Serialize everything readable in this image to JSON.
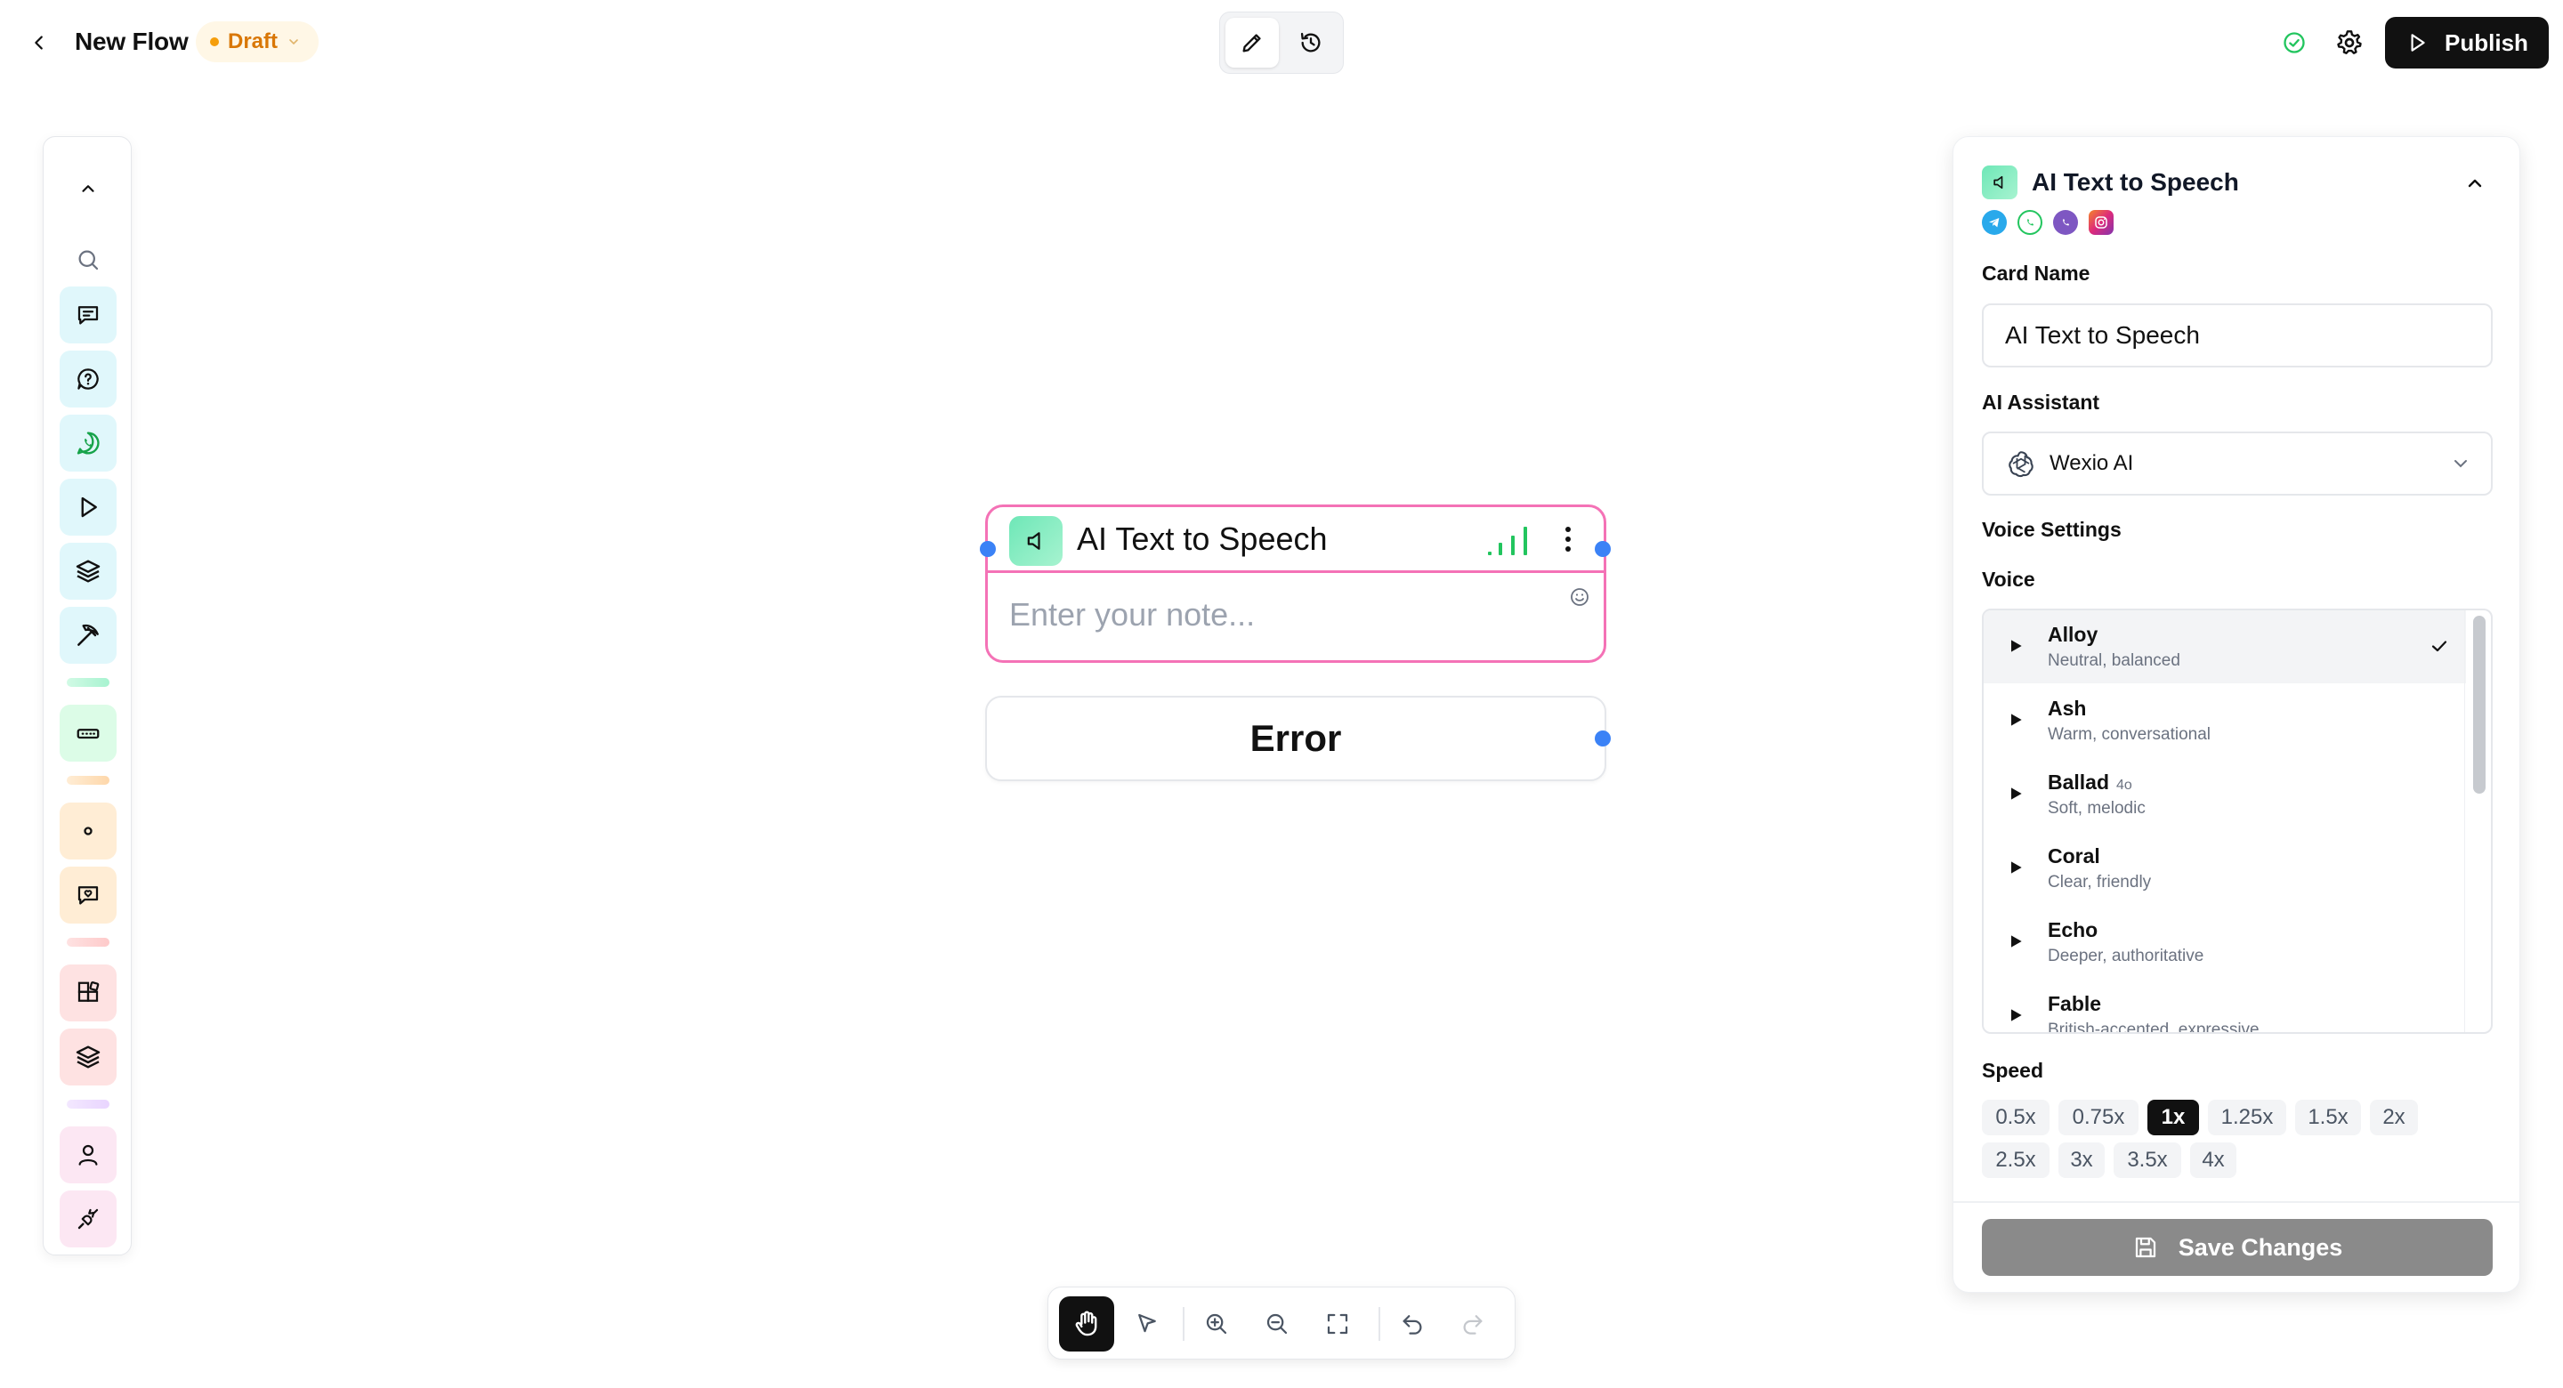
{
  "header": {
    "title": "New Flow",
    "status_badge": "Draft",
    "publish_label": "Publish"
  },
  "canvas": {
    "node": {
      "title": "AI Text to Speech",
      "note_placeholder": "Enter your note..."
    },
    "error_node": {
      "label": "Error"
    }
  },
  "panel": {
    "title": "AI Text to Speech",
    "card_name_label": "Card Name",
    "card_name_value": "AI Text to Speech",
    "assistant_label": "AI Assistant",
    "assistant_value": "Wexio AI",
    "voice_settings_label": "Voice Settings",
    "voice_label": "Voice",
    "voices": [
      {
        "name": "Alloy",
        "tag": "",
        "desc": "Neutral, balanced",
        "selected": true
      },
      {
        "name": "Ash",
        "tag": "",
        "desc": "Warm, conversational",
        "selected": false
      },
      {
        "name": "Ballad",
        "tag": "4o",
        "desc": "Soft, melodic",
        "selected": false
      },
      {
        "name": "Coral",
        "tag": "",
        "desc": "Clear, friendly",
        "selected": false
      },
      {
        "name": "Echo",
        "tag": "",
        "desc": "Deeper, authoritative",
        "selected": false
      },
      {
        "name": "Fable",
        "tag": "",
        "desc": "British-accented, expressive",
        "selected": false
      }
    ],
    "speed_label": "Speed",
    "speeds": [
      "0.5x",
      "0.75x",
      "1x",
      "1.25x",
      "1.5x",
      "2x",
      "2.5x",
      "3x",
      "3.5x",
      "4x"
    ],
    "selected_speed": "1x",
    "save_label": "Save Changes"
  },
  "colors": {
    "accent_pink": "#f472b6",
    "handle_blue": "#3b82f6",
    "draft_orange": "#d97706",
    "tts_green": "#6ee7b7"
  }
}
